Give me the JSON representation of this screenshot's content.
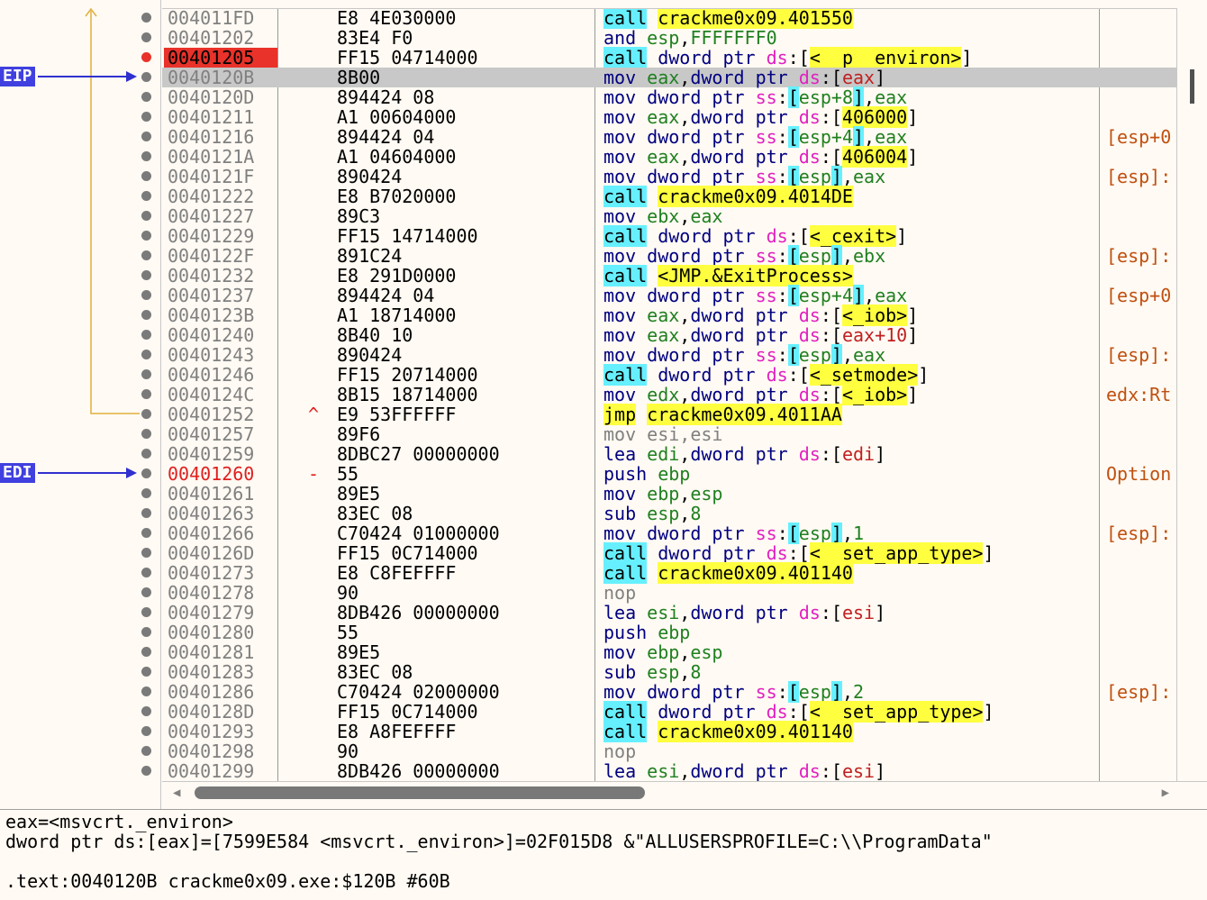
{
  "registers": {
    "eip_label": "EIP",
    "edi_label": "EDI"
  },
  "rows": [
    {
      "addr": "004011FD",
      "bytes": "E8 4E030000",
      "cmt": ""
    },
    {
      "addr": "00401202",
      "bytes": "83E4 F0",
      "cmt": ""
    },
    {
      "addr": "00401205",
      "bytes": "FF15 04714000",
      "cmt": ""
    },
    {
      "addr": "0040120B",
      "bytes": "8B00",
      "cmt": ""
    },
    {
      "addr": "0040120D",
      "bytes": "894424 08",
      "cmt": ""
    },
    {
      "addr": "00401211",
      "bytes": "A1 00604000",
      "cmt": ""
    },
    {
      "addr": "00401216",
      "bytes": "894424 04",
      "cmt": "[esp+0"
    },
    {
      "addr": "0040121A",
      "bytes": "A1 04604000",
      "cmt": ""
    },
    {
      "addr": "0040121F",
      "bytes": "890424",
      "cmt": "[esp]:"
    },
    {
      "addr": "00401222",
      "bytes": "E8 B7020000",
      "cmt": ""
    },
    {
      "addr": "00401227",
      "bytes": "89C3",
      "cmt": ""
    },
    {
      "addr": "00401229",
      "bytes": "FF15 14714000",
      "cmt": ""
    },
    {
      "addr": "0040122F",
      "bytes": "891C24",
      "cmt": "[esp]:"
    },
    {
      "addr": "00401232",
      "bytes": "E8 291D0000",
      "cmt": ""
    },
    {
      "addr": "00401237",
      "bytes": "894424 04",
      "cmt": "[esp+0"
    },
    {
      "addr": "0040123B",
      "bytes": "A1 18714000",
      "cmt": ""
    },
    {
      "addr": "00401240",
      "bytes": "8B40 10",
      "cmt": ""
    },
    {
      "addr": "00401243",
      "bytes": "890424",
      "cmt": "[esp]:"
    },
    {
      "addr": "00401246",
      "bytes": "FF15 20714000",
      "cmt": ""
    },
    {
      "addr": "0040124C",
      "bytes": "8B15 18714000",
      "cmt": "edx:Rt"
    },
    {
      "addr": "00401252",
      "bytes": "E9 53FFFFFF",
      "cmt": "",
      "mark": "^"
    },
    {
      "addr": "00401257",
      "bytes": "89F6",
      "cmt": ""
    },
    {
      "addr": "00401259",
      "bytes": "8DBC27 00000000",
      "cmt": ""
    },
    {
      "addr": "00401260",
      "bytes": "55",
      "cmt": "Option",
      "mark": "-"
    },
    {
      "addr": "00401261",
      "bytes": "89E5",
      "cmt": ""
    },
    {
      "addr": "00401263",
      "bytes": "83EC 08",
      "cmt": ""
    },
    {
      "addr": "00401266",
      "bytes": "C70424 01000000",
      "cmt": "[esp]:"
    },
    {
      "addr": "0040126D",
      "bytes": "FF15 0C714000",
      "cmt": ""
    },
    {
      "addr": "00401273",
      "bytes": "E8 C8FEFFFF",
      "cmt": ""
    },
    {
      "addr": "00401278",
      "bytes": "90",
      "cmt": ""
    },
    {
      "addr": "00401279",
      "bytes": "8DB426 00000000",
      "cmt": ""
    },
    {
      "addr": "00401280",
      "bytes": "55",
      "cmt": ""
    },
    {
      "addr": "00401281",
      "bytes": "89E5",
      "cmt": ""
    },
    {
      "addr": "00401283",
      "bytes": "83EC 08",
      "cmt": ""
    },
    {
      "addr": "00401286",
      "bytes": "C70424 02000000",
      "cmt": "[esp]:"
    },
    {
      "addr": "0040128D",
      "bytes": "FF15 0C714000",
      "cmt": ""
    },
    {
      "addr": "00401293",
      "bytes": "E8 A8FEFFFF",
      "cmt": ""
    },
    {
      "addr": "00401298",
      "bytes": "90",
      "cmt": ""
    },
    {
      "addr": "00401299",
      "bytes": "8DB426 00000000",
      "cmt": ""
    }
  ],
  "info": {
    "line1": "eax=<msvcrt._environ>",
    "line2": "dword ptr ds:[eax]=[7599E584 <msvcrt._environ>]=02F015D8 &\"ALLUSERSPROFILE=C:\\\\ProgramData\"",
    "line3": "",
    "line4": ".text:0040120B crackme0x09.exe:$120B #60B"
  }
}
